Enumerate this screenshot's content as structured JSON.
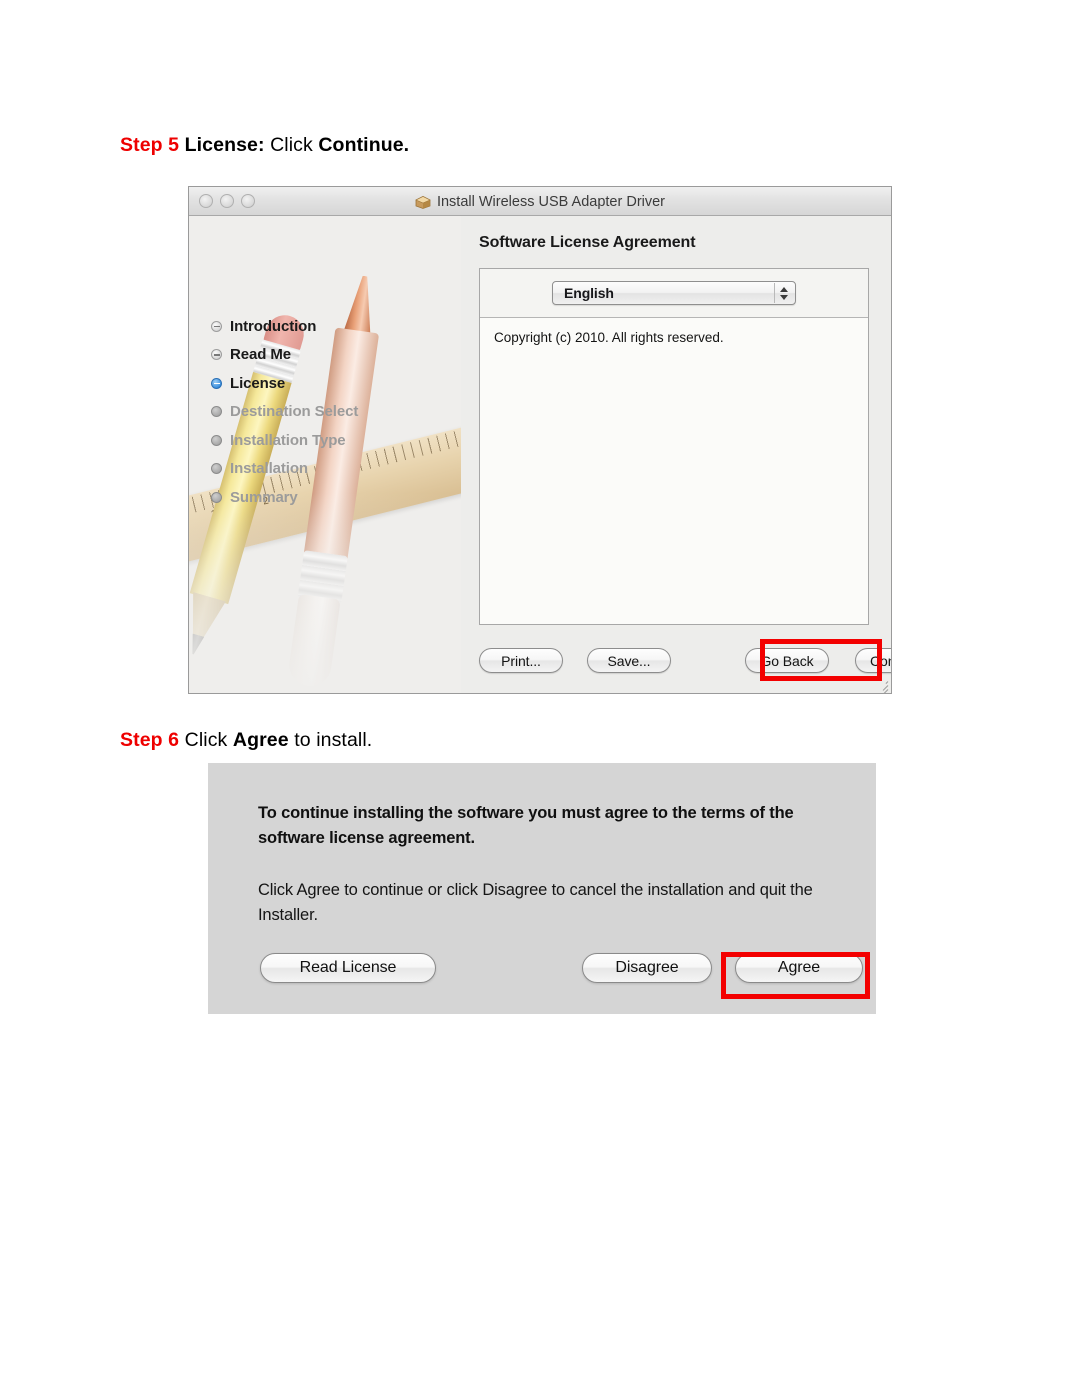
{
  "steps": [
    {
      "number_label": "Step 5",
      "text_before_bold": " ",
      "bold_1": "License:",
      "mid": " Click ",
      "bold_2": "Continue."
    },
    {
      "number_label": "Step 6",
      "mid_1": " Click ",
      "bold_1": "Agree",
      "mid_2": " to install."
    }
  ],
  "colors": {
    "step_red": "#ee0000",
    "highlight_red": "#f30000",
    "dialog_bg": "#d5d5d5",
    "window_bg": "#ededeb"
  },
  "installer_window": {
    "title": "Install Wireless USB Adapter Driver",
    "title_icon": "package-icon",
    "traffic_lights": [
      "close-button",
      "minimize-button",
      "zoom-button"
    ],
    "pane_title": "Software License Agreement",
    "sidebar_steps": [
      {
        "label": "Introduction",
        "state": "done"
      },
      {
        "label": "Read Me",
        "state": "done"
      },
      {
        "label": "License",
        "state": "current"
      },
      {
        "label": "Destination Select",
        "state": "pending"
      },
      {
        "label": "Installation Type",
        "state": "pending"
      },
      {
        "label": "Installation",
        "state": "pending"
      },
      {
        "label": "Summary",
        "state": "pending"
      }
    ],
    "language_select": {
      "value": "English",
      "options": [
        "English"
      ]
    },
    "license_body": "Copyright (c) 2010.  All rights reserved.",
    "buttons": {
      "print": "Print...",
      "save": "Save...",
      "go_back": "Go Back",
      "continue": "Continue"
    }
  },
  "agree_dialog": {
    "paragraph_1": "To continue installing the software you must agree to the terms of the software license agreement.",
    "paragraph_2": "Click Agree to continue or click Disagree to cancel the installation and quit the Installer.",
    "buttons": {
      "read_license": "Read License",
      "disagree": "Disagree",
      "agree": "Agree"
    }
  }
}
